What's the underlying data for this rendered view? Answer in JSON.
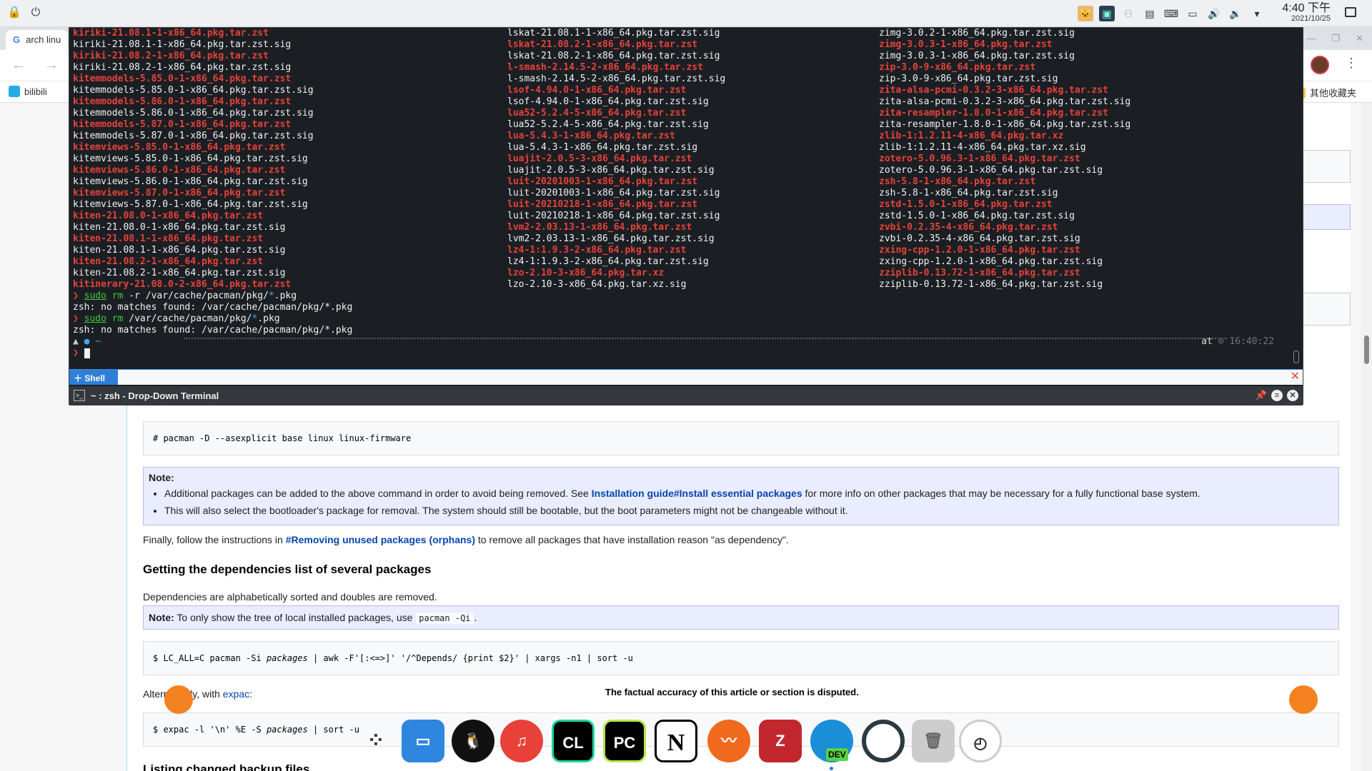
{
  "panel": {
    "time": "4:40 下午",
    "date": "2021/10/25"
  },
  "browser": {
    "tab_title": "arch linu",
    "bookmark_1": "bilibili",
    "bookmark_2": "其他收藏夹"
  },
  "terminal": {
    "col1": [
      {
        "t": "kiriki-21.08.1-1-x86_64.pkg.tar.zst",
        "c": "red"
      },
      {
        "t": "kiriki-21.08.1-1-x86_64.pkg.tar.zst.sig",
        "c": "wht"
      },
      {
        "t": "kiriki-21.08.2-1-x86_64.pkg.tar.zst",
        "c": "red"
      },
      {
        "t": "kiriki-21.08.2-1-x86_64.pkg.tar.zst.sig",
        "c": "wht"
      },
      {
        "t": "kitemmodels-5.85.0-1-x86_64.pkg.tar.zst",
        "c": "red"
      },
      {
        "t": "kitemmodels-5.85.0-1-x86_64.pkg.tar.zst.sig",
        "c": "wht"
      },
      {
        "t": "kitemmodels-5.86.0-1-x86_64.pkg.tar.zst",
        "c": "red"
      },
      {
        "t": "kitemmodels-5.86.0-1-x86_64.pkg.tar.zst.sig",
        "c": "wht"
      },
      {
        "t": "kitemmodels-5.87.0-1-x86_64.pkg.tar.zst",
        "c": "red"
      },
      {
        "t": "kitemmodels-5.87.0-1-x86_64.pkg.tar.zst.sig",
        "c": "wht"
      },
      {
        "t": "kitemviews-5.85.0-1-x86_64.pkg.tar.zst",
        "c": "red"
      },
      {
        "t": "kitemviews-5.85.0-1-x86_64.pkg.tar.zst.sig",
        "c": "wht"
      },
      {
        "t": "kitemviews-5.86.0-1-x86_64.pkg.tar.zst",
        "c": "red"
      },
      {
        "t": "kitemviews-5.86.0-1-x86_64.pkg.tar.zst.sig",
        "c": "wht"
      },
      {
        "t": "kitemviews-5.87.0-1-x86_64.pkg.tar.zst",
        "c": "red"
      },
      {
        "t": "kitemviews-5.87.0-1-x86_64.pkg.tar.zst.sig",
        "c": "wht"
      },
      {
        "t": "kiten-21.08.0-1-x86_64.pkg.tar.zst",
        "c": "red"
      },
      {
        "t": "kiten-21.08.0-1-x86_64.pkg.tar.zst.sig",
        "c": "wht"
      },
      {
        "t": "kiten-21.08.1-1-x86_64.pkg.tar.zst",
        "c": "red"
      },
      {
        "t": "kiten-21.08.1-1-x86_64.pkg.tar.zst.sig",
        "c": "wht"
      },
      {
        "t": "kiten-21.08.2-1-x86_64.pkg.tar.zst",
        "c": "red"
      },
      {
        "t": "kiten-21.08.2-1-x86_64.pkg.tar.zst.sig",
        "c": "wht"
      },
      {
        "t": "kitinerary-21.08.0-2-x86_64.pkg.tar.zst",
        "c": "red"
      }
    ],
    "col2": [
      {
        "t": "lskat-21.08.1-1-x86_64.pkg.tar.zst.sig",
        "c": "wht"
      },
      {
        "t": "lskat-21.08.2-1-x86_64.pkg.tar.zst",
        "c": "red"
      },
      {
        "t": "lskat-21.08.2-1-x86_64.pkg.tar.zst.sig",
        "c": "wht"
      },
      {
        "t": "l-smash-2.14.5-2-x86_64.pkg.tar.zst",
        "c": "red"
      },
      {
        "t": "l-smash-2.14.5-2-x86_64.pkg.tar.zst.sig",
        "c": "wht"
      },
      {
        "t": "lsof-4.94.0-1-x86_64.pkg.tar.zst",
        "c": "red"
      },
      {
        "t": "lsof-4.94.0-1-x86_64.pkg.tar.zst.sig",
        "c": "wht"
      },
      {
        "t": "lua52-5.2.4-5-x86_64.pkg.tar.zst",
        "c": "red"
      },
      {
        "t": "lua52-5.2.4-5-x86_64.pkg.tar.zst.sig",
        "c": "wht"
      },
      {
        "t": "lua-5.4.3-1-x86_64.pkg.tar.zst",
        "c": "red"
      },
      {
        "t": "lua-5.4.3-1-x86_64.pkg.tar.zst.sig",
        "c": "wht"
      },
      {
        "t": "luajit-2.0.5-3-x86_64.pkg.tar.zst",
        "c": "red"
      },
      {
        "t": "luajit-2.0.5-3-x86_64.pkg.tar.zst.sig",
        "c": "wht"
      },
      {
        "t": "luit-20201003-1-x86_64.pkg.tar.zst",
        "c": "red"
      },
      {
        "t": "luit-20201003-1-x86_64.pkg.tar.zst.sig",
        "c": "wht"
      },
      {
        "t": "luit-20210218-1-x86_64.pkg.tar.zst",
        "c": "red"
      },
      {
        "t": "luit-20210218-1-x86_64.pkg.tar.zst.sig",
        "c": "wht"
      },
      {
        "t": "lvm2-2.03.13-1-x86_64.pkg.tar.zst",
        "c": "red"
      },
      {
        "t": "lvm2-2.03.13-1-x86_64.pkg.tar.zst.sig",
        "c": "wht"
      },
      {
        "t": "lz4-1:1.9.3-2-x86_64.pkg.tar.zst",
        "c": "red"
      },
      {
        "t": "lz4-1:1.9.3-2-x86_64.pkg.tar.zst.sig",
        "c": "wht"
      },
      {
        "t": "lzo-2.10-3-x86_64.pkg.tar.xz",
        "c": "red"
      },
      {
        "t": "lzo-2.10-3-x86_64.pkg.tar.xz.sig",
        "c": "wht"
      }
    ],
    "col3": [
      {
        "t": "zimg-3.0.2-1-x86_64.pkg.tar.zst.sig",
        "c": "wht"
      },
      {
        "t": "zimg-3.0.3-1-x86_64.pkg.tar.zst",
        "c": "red"
      },
      {
        "t": "zimg-3.0.3-1-x86_64.pkg.tar.zst.sig",
        "c": "wht"
      },
      {
        "t": "zip-3.0-9-x86_64.pkg.tar.zst",
        "c": "red"
      },
      {
        "t": "zip-3.0-9-x86_64.pkg.tar.zst.sig",
        "c": "wht"
      },
      {
        "t": "zita-alsa-pcmi-0.3.2-3-x86_64.pkg.tar.zst",
        "c": "red"
      },
      {
        "t": "zita-alsa-pcmi-0.3.2-3-x86_64.pkg.tar.zst.sig",
        "c": "wht"
      },
      {
        "t": "zita-resampler-1.8.0-1-x86_64.pkg.tar.zst",
        "c": "red"
      },
      {
        "t": "zita-resampler-1.8.0-1-x86_64.pkg.tar.zst.sig",
        "c": "wht"
      },
      {
        "t": "zlib-1:1.2.11-4-x86_64.pkg.tar.xz",
        "c": "red"
      },
      {
        "t": "zlib-1:1.2.11-4-x86_64.pkg.tar.xz.sig",
        "c": "wht"
      },
      {
        "t": "zotero-5.0.96.3-1-x86_64.pkg.tar.zst",
        "c": "red"
      },
      {
        "t": "zotero-5.0.96.3-1-x86_64.pkg.tar.zst.sig",
        "c": "wht"
      },
      {
        "t": "zsh-5.8-1-x86_64.pkg.tar.zst",
        "c": "red"
      },
      {
        "t": "zsh-5.8-1-x86_64.pkg.tar.zst.sig",
        "c": "wht"
      },
      {
        "t": "zstd-1.5.0-1-x86_64.pkg.tar.zst",
        "c": "red"
      },
      {
        "t": "zstd-1.5.0-1-x86_64.pkg.tar.zst.sig",
        "c": "wht"
      },
      {
        "t": "zvbi-0.2.35-4-x86_64.pkg.tar.zst",
        "c": "red"
      },
      {
        "t": "zvbi-0.2.35-4-x86_64.pkg.tar.zst.sig",
        "c": "wht"
      },
      {
        "t": "zxing-cpp-1.2.0-1-x86_64.pkg.tar.zst",
        "c": "red"
      },
      {
        "t": "zxing-cpp-1.2.0-1-x86_64.pkg.tar.zst.sig",
        "c": "wht"
      },
      {
        "t": "zziplib-0.13.72-1-x86_64.pkg.tar.zst",
        "c": "red"
      },
      {
        "t": "zziplib-0.13.72-1-x86_64.pkg.tar.zst.sig",
        "c": "wht"
      }
    ],
    "cmd1_sudo": "sudo",
    "cmd1_rm": "rm",
    "cmd1_args": " -r /var/cache/pacman/pkg/",
    "cmd1_glob": "*",
    "cmd1_ext": ".pkg",
    "err1": "zsh: no matches found: /var/cache/pacman/pkg/*.pkg",
    "cmd2_args": " /var/cache/pacman/pkg/",
    "err2": "zsh: no matches found: /var/cache/pacman/pkg/*.pkg",
    "status_at": "at",
    "status_time": "16:40:22",
    "shell_tab": "Shell",
    "window_title": "~ : zsh - Drop-Down Terminal"
  },
  "wiki": {
    "code_pacman_d": "# pacman -D --asexplicit base linux linux-firmware",
    "note1_label": "Note:",
    "note1_li1_pre": "Additional packages can be added to the above command in order to avoid being removed. See ",
    "note1_li1_link": "Installation guide#Install essential packages",
    "note1_li1_post": " for more info on other packages that may be necessary for a fully functional base system.",
    "note1_li2": "This will also select the bootloader's package for removal. The system should still be bootable, but the boot parameters might not be changeable without it.",
    "finally_pre": "Finally, follow the instructions in ",
    "finally_link": "#Removing unused packages (orphans)",
    "finally_post": " to remove all packages that have installation reason \"as dependency\".",
    "heading_deps": "Getting the dependencies list of several packages",
    "deps_para": "Dependencies are alphabetically sorted and doubles are removed.",
    "note2_label": "Note:",
    "note2_text": " To only show the tree of local installed packages, use ",
    "note2_code": "pacman -Qi",
    "note2_end": ".",
    "code_lcall_pre": "$ LC_ALL=C pacman -Si ",
    "code_lcall_em": "packages",
    "code_lcall_post": " | awk -F'[:<=>]' '/^Depends/ {print $2}' | xargs -n1 | sort -u",
    "alt_pre": "Alternatively, with ",
    "alt_link": "expac",
    "alt_post": ":",
    "code_expac_pre": "$ expac -l '\\n' %E -S ",
    "code_expac_em": "packages",
    "code_expac_post": " | sort -u",
    "heading_backup": "Listing changed backup files",
    "disputed": "The factual accuracy of this article or section is disputed."
  },
  "dock": {
    "clion_label": "CL",
    "pycharm_label": "PC",
    "notion_label": "N",
    "zotero_label": "Z",
    "edge_badge": "DEV"
  },
  "colors": {
    "term_bg": "#1b1f23",
    "term_red": "#e8413a",
    "wiki_link": "#0645ad",
    "note_bg": "#eaecff"
  }
}
